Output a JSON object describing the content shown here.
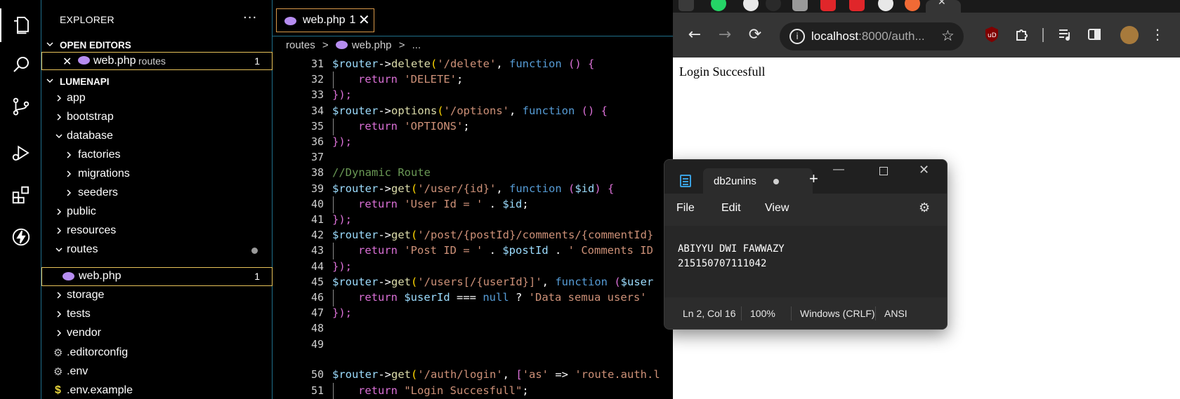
{
  "vscode": {
    "explorer_title": "EXPLORER",
    "explorer_more": "···",
    "open_editors_label": "OPEN EDITORS",
    "open_editor_file": "web.php",
    "open_editor_folder": "routes",
    "open_editor_badge": "1",
    "project_label": "LUMENAPI",
    "tree": [
      {
        "label": "app"
      },
      {
        "label": "bootstrap"
      },
      {
        "label": "database"
      },
      {
        "label": "factories"
      },
      {
        "label": "migrations"
      },
      {
        "label": "seeders"
      },
      {
        "label": "public"
      },
      {
        "label": "resources"
      },
      {
        "label": "routes"
      },
      {
        "label": "web.php",
        "badge": "1"
      },
      {
        "label": "storage"
      },
      {
        "label": "tests"
      },
      {
        "label": "vendor"
      },
      {
        "label": ".editorconfig"
      },
      {
        "label": ".env"
      },
      {
        "label": ".env.example"
      }
    ],
    "tab_label": "web.php",
    "tab_badge": "1",
    "tab_close": "✕",
    "breadcrumb": [
      "routes",
      ">",
      "web.php",
      ">",
      "..."
    ],
    "code_lines": [
      {
        "n": "31"
      },
      {
        "n": "32"
      },
      {
        "n": "33"
      },
      {
        "n": "34"
      },
      {
        "n": "35"
      },
      {
        "n": "36"
      },
      {
        "n": "37"
      },
      {
        "n": "38"
      },
      {
        "n": "39"
      },
      {
        "n": "40"
      },
      {
        "n": "41"
      },
      {
        "n": "42"
      },
      {
        "n": "43"
      },
      {
        "n": "44"
      },
      {
        "n": "45"
      },
      {
        "n": "46"
      },
      {
        "n": "47"
      },
      {
        "n": "48"
      },
      {
        "n": "49"
      },
      {
        "n": "50"
      },
      {
        "n": "51"
      }
    ],
    "code_text": {
      "l31": [
        "$router",
        "->",
        "delete",
        "(",
        "'/delete'",
        ", ",
        "function",
        " () {"
      ],
      "l32": [
        "return",
        " ",
        "'DELETE'",
        ";"
      ],
      "l33": [
        "});"
      ],
      "l34": [
        "$router",
        "->",
        "options",
        "(",
        "'/options'",
        ", ",
        "function",
        " () {"
      ],
      "l35": [
        "return",
        " ",
        "'OPTIONS'",
        ";"
      ],
      "l36": [
        "});"
      ],
      "l38": [
        "//Dynamic Route"
      ],
      "l39": [
        "$router",
        "->",
        "get",
        "(",
        "'/user/{id}'",
        ", ",
        "function",
        " (",
        "$id",
        ") {"
      ],
      "l40": [
        "return",
        " ",
        "'User Id = '",
        " . ",
        "$id",
        ";"
      ],
      "l41": [
        "});"
      ],
      "l42": [
        "$router",
        "->",
        "get",
        "(",
        "'/post/{postId}/comments/{commentId}"
      ],
      "l43": [
        "return",
        " ",
        "'Post ID = '",
        " . ",
        "$postId",
        " . ",
        "' Comments ID"
      ],
      "l44": [
        "});"
      ],
      "l45": [
        "$router",
        "->",
        "get",
        "(",
        "'/users[/{userId}]'",
        ", ",
        "function",
        " (",
        "$user"
      ],
      "l46": [
        "return",
        " ",
        "$userId",
        " === ",
        "null",
        " ? ",
        "'Data semua users'"
      ],
      "l47": [
        "});"
      ],
      "l50": [
        "$router",
        "->",
        "get",
        "(",
        "'/auth/login'",
        ", ",
        "[",
        "'as'",
        " => ",
        "'route.auth.l"
      ],
      "l51": [
        "return",
        " ",
        "\"Login Succesfull\"",
        ";"
      ]
    }
  },
  "chrome": {
    "url_host": "localhost",
    "url_path": ":8000/auth...",
    "info_icon": "i",
    "star": "☆",
    "back": "←",
    "forward": "→",
    "reload": "⟳",
    "page_text": "Login Succesfull"
  },
  "notepad": {
    "tab_name": "db2unins",
    "new_tab": "+",
    "min": "—",
    "close": "✕",
    "menu": [
      "File",
      "Edit",
      "View"
    ],
    "settings": "⚙",
    "lines": [
      "ABIYYU DWI FAWWAZY",
      "215150707111042"
    ],
    "status": [
      "Ln 2, Col 16",
      "100%",
      "Windows (CRLF)",
      "ANSI"
    ]
  },
  "colors": {
    "accent_border": "#1f6f8b",
    "tab_border": "#d99a4a",
    "php_icon": "#b68df0"
  }
}
